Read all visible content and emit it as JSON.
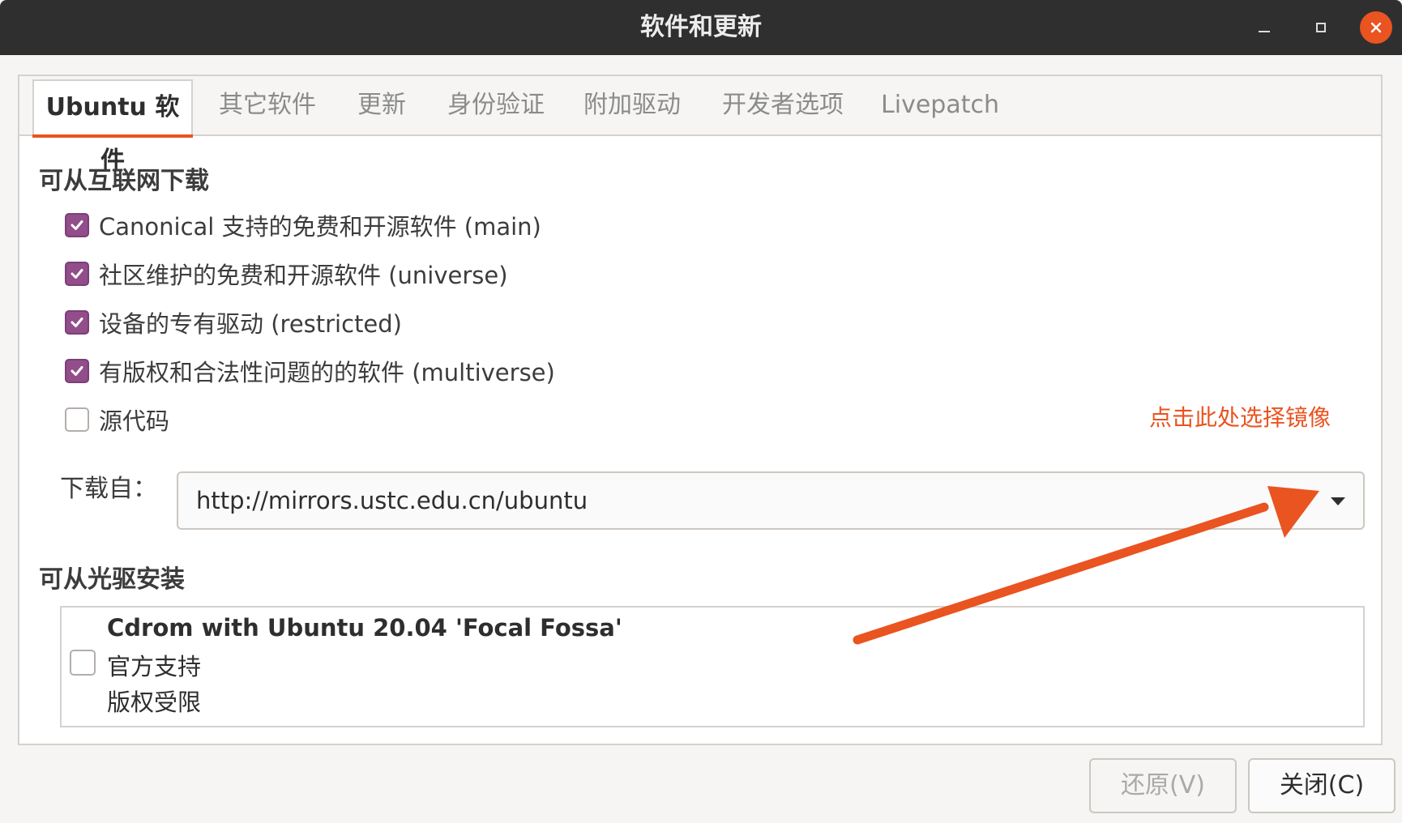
{
  "window": {
    "title": "软件和更新"
  },
  "tabs": [
    {
      "label": "Ubuntu 软件",
      "active": true
    },
    {
      "label": "其它软件"
    },
    {
      "label": "更新"
    },
    {
      "label": "身份验证"
    },
    {
      "label": "附加驱动"
    },
    {
      "label": "开发者选项"
    },
    {
      "label": "Livepatch"
    }
  ],
  "internet": {
    "heading": "可从互联网下载",
    "items": [
      {
        "label": "Canonical 支持的免费和开源软件 (main)",
        "checked": true
      },
      {
        "label": "社区维护的免费和开源软件 (universe)",
        "checked": true
      },
      {
        "label": "设备的专有驱动 (restricted)",
        "checked": true
      },
      {
        "label": "有版权和合法性问题的的软件 (multiverse)",
        "checked": true
      },
      {
        "label": "源代码",
        "checked": false
      }
    ],
    "download_label": "下载自：",
    "mirror": "http://mirrors.ustc.edu.cn/ubuntu"
  },
  "annotation": {
    "text": "点击此处选择镜像",
    "color": "#e95420"
  },
  "cdrom": {
    "heading": "可从光驱安装",
    "title": "Cdrom with Ubuntu 20.04 'Focal Fossa'",
    "line1": "官方支持",
    "line2": "版权受限",
    "checked": false
  },
  "buttons": {
    "revert": "还原(V)",
    "close": "关闭(C)"
  },
  "colors": {
    "accent": "#e95420",
    "check": "#924d8b",
    "titlebar": "#2f2f2f"
  },
  "icons": [
    "minimize-icon",
    "maximize-icon",
    "close-icon",
    "checkmark-icon",
    "dropdown-arrow-icon"
  ]
}
